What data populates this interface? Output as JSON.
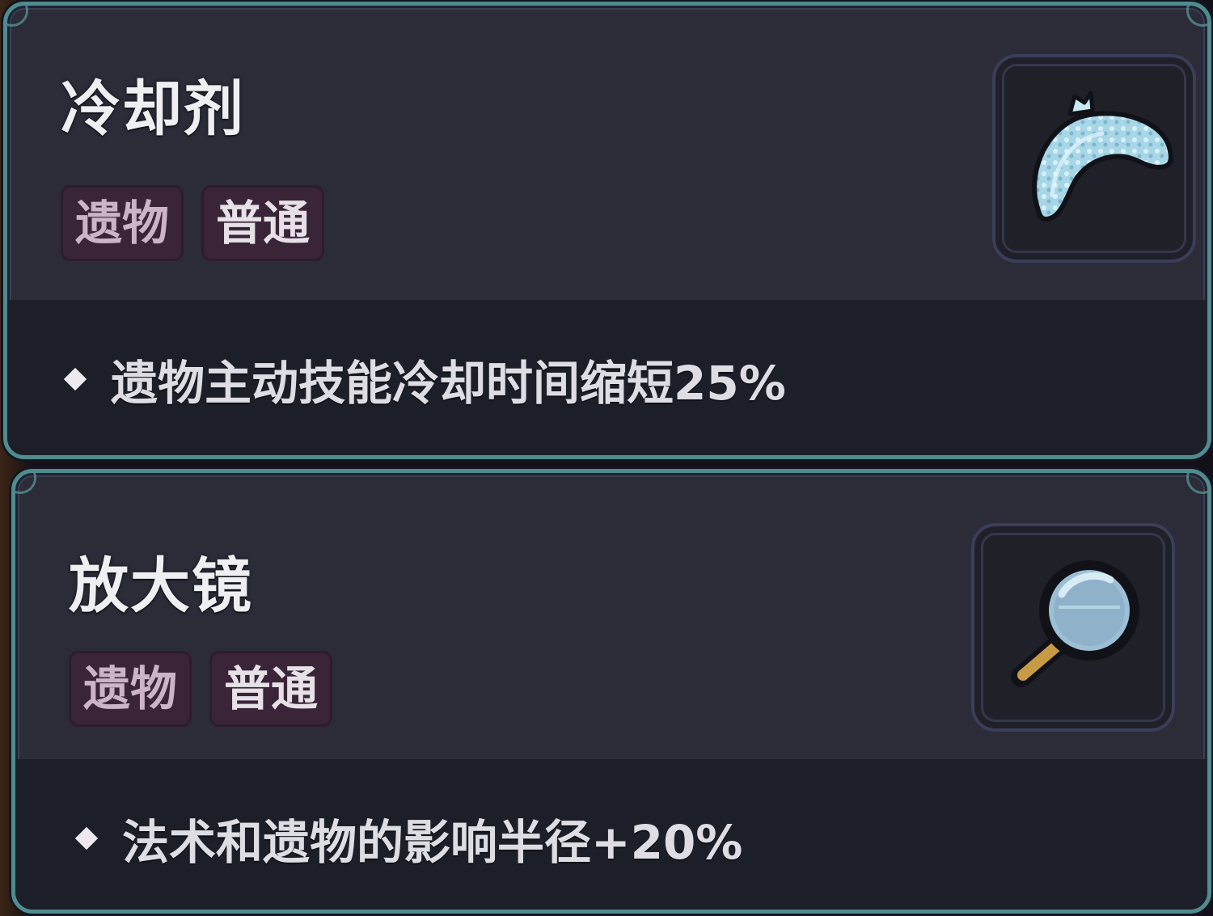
{
  "relics": [
    {
      "name": "冷却剂",
      "tags": [
        "遗物",
        "普通"
      ],
      "description": "遗物主动技能冷却时间缩短25%",
      "icon": "ice-pack-icon"
    },
    {
      "name": "放大镜",
      "tags": [
        "遗物",
        "普通"
      ],
      "description": "法术和遗物的影响半径+20%",
      "icon": "magnifying-glass-icon"
    }
  ],
  "colors": {
    "card_bg": "#2b2c38",
    "card_border": "#4f8c90",
    "desc_band": "#1d1f28",
    "tag_bg": "#3a2438",
    "tag_text_type": "#cbb3c8",
    "tag_text_rarity": "#e6e0e7",
    "title_text": "#efeef1",
    "ice_pack": "#9fd0e2",
    "lens": "#9dbfd6",
    "handle": "#c79a45"
  }
}
